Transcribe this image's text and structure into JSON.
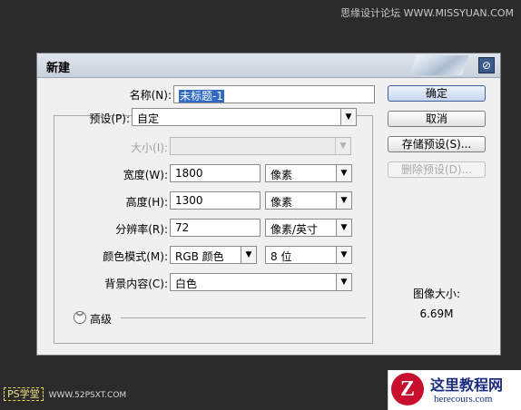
{
  "watermark_top": "思缘设计论坛  WWW.MISSYUAN.COM",
  "dialog": {
    "title": "新建",
    "close_icon": "close-icon",
    "name_label": "名称(N):",
    "name_value": "未标题-1",
    "preset_label": "预设(P):",
    "preset_value": "自定",
    "size_label": "大小(I):",
    "size_value": "",
    "width_label": "宽度(W):",
    "width_value": "1800",
    "width_unit": "像素",
    "height_label": "高度(H):",
    "height_value": "1300",
    "height_unit": "像素",
    "resolution_label": "分辨率(R):",
    "resolution_value": "72",
    "resolution_unit": "像素/英寸",
    "color_mode_label": "颜色模式(M):",
    "color_mode_value": "RGB 颜色",
    "bit_depth_value": "8 位",
    "background_label": "背景内容(C):",
    "background_value": "白色",
    "advanced_label": "高级",
    "buttons": {
      "ok": "确定",
      "cancel": "取消",
      "save_preset": "存储预设(S)...",
      "delete_preset": "删除预设(D)..."
    },
    "image_size_label": "图像大小:",
    "image_size_value": "6.69M"
  },
  "logos": {
    "ps_text": "PS学堂",
    "ps_url": "WWW.52PSXT.COM",
    "here_title": "这里教程网",
    "here_url": "herecours.com"
  }
}
